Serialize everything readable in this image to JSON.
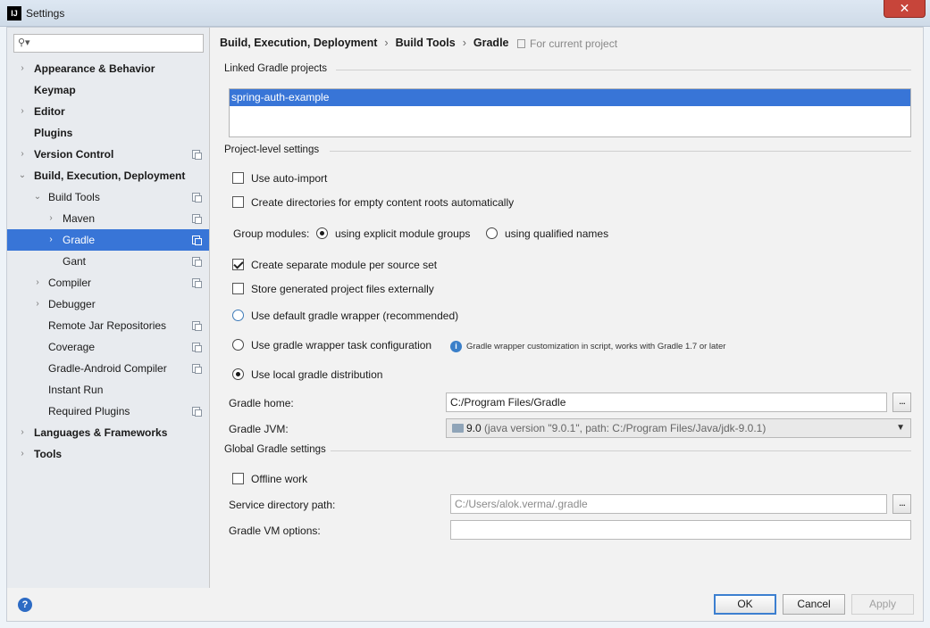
{
  "window": {
    "title": "Settings",
    "app_icon_text": "IJ",
    "close_glyph": "✕"
  },
  "sidebar": {
    "search_placeholder": "",
    "items": [
      {
        "label": "Appearance & Behavior",
        "arrow": "›"
      },
      {
        "label": "Keymap"
      },
      {
        "label": "Editor",
        "arrow": "›"
      },
      {
        "label": "Plugins"
      },
      {
        "label": "Version Control",
        "arrow": "›"
      },
      {
        "label": "Build, Execution, Deployment",
        "arrow": "⌄"
      },
      {
        "label": "Build Tools",
        "arrow": "⌄"
      },
      {
        "label": "Maven",
        "arrow": "›"
      },
      {
        "label": "Gradle",
        "arrow": "›"
      },
      {
        "label": "Gant"
      },
      {
        "label": "Compiler",
        "arrow": "›"
      },
      {
        "label": "Debugger",
        "arrow": "›"
      },
      {
        "label": "Remote Jar Repositories"
      },
      {
        "label": "Coverage"
      },
      {
        "label": "Gradle-Android Compiler"
      },
      {
        "label": "Instant Run"
      },
      {
        "label": "Required Plugins"
      },
      {
        "label": "Languages & Frameworks",
        "arrow": "›"
      },
      {
        "label": "Tools",
        "arrow": "›"
      }
    ]
  },
  "breadcrumb": {
    "items": [
      "Build, Execution, Deployment",
      "Build Tools",
      "Gradle"
    ],
    "separator": "›",
    "scope": "For current project"
  },
  "linked": {
    "title": "Linked Gradle projects",
    "projects": [
      "spring-auth-example"
    ]
  },
  "project_settings": {
    "title": "Project-level settings",
    "auto_import": "Use auto-import",
    "create_dirs": "Create directories for empty content roots automatically",
    "group_modules_label": "Group modules:",
    "group_explicit": "using explicit module groups",
    "group_qualified": "using qualified names",
    "separate_module": "Create separate module per source set",
    "store_external": "Store generated project files externally",
    "default_wrapper": "Use default gradle wrapper (recommended)",
    "wrapper_task": "Use gradle wrapper task configuration",
    "wrapper_hint": "Gradle wrapper customization in script, works with Gradle 1.7 or later",
    "local_dist": "Use local gradle distribution",
    "gradle_home_label": "Gradle home:",
    "gradle_home_value": "C:/Program Files/Gradle",
    "gradle_jvm_label": "Gradle JVM:",
    "gradle_jvm_version": "9.0",
    "gradle_jvm_detail": " (java version \"9.0.1\", path: C:/Program Files/Java/jdk-9.0.1)",
    "browse_label": "..."
  },
  "global_settings": {
    "title": "Global Gradle settings",
    "offline_work": "Offline work",
    "service_dir_label": "Service directory path:",
    "service_dir_value": "C:/Users/alok.verma/.gradle",
    "vm_options_label": "Gradle VM options:",
    "vm_options_value": ""
  },
  "footer": {
    "help": "?",
    "ok": "OK",
    "cancel": "Cancel",
    "apply": "Apply"
  },
  "colors": {
    "selection": "#3875d7",
    "sidebar_bg": "#e8ebef",
    "close_button": "#c7453a"
  }
}
